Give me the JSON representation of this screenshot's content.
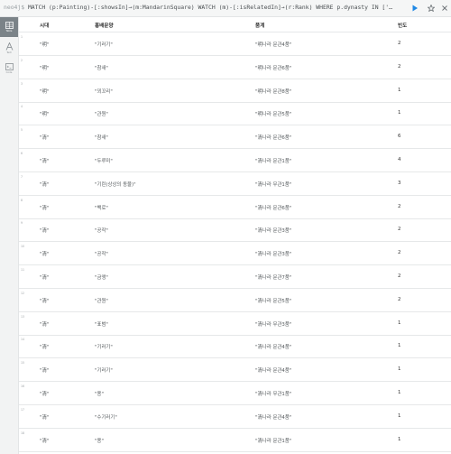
{
  "query_bar": {
    "prompt": "neo4j$",
    "query": "MATCH (p:Painting)-[:showsIn]→(m:MandarinSquare) WATCH (m)-[:isRelatedIn]→(r:Rank) WHERE p.dynasty IN ['…"
  },
  "toolbar": {
    "run_icon": "play-icon",
    "favorite_icon": "star-icon",
    "close_icon": "close-icon",
    "accent_color": "#1e88e5"
  },
  "sidebar": {
    "items": [
      {
        "label": "Table",
        "icon": "table-icon",
        "active": true
      },
      {
        "label": "Text",
        "icon": "text-icon",
        "active": false
      },
      {
        "label": "Code",
        "icon": "code-icon",
        "active": false
      }
    ]
  },
  "table": {
    "headers": [
      "시대",
      "흉배문양",
      "품계",
      "빈도"
    ],
    "rows": [
      {
        "n": "1",
        "cells": [
          "\"明\"",
          "\"기러기\"",
          "\"明나라 문관4품\"",
          "2"
        ]
      },
      {
        "n": "2",
        "cells": [
          "\"明\"",
          "\"참새\"",
          "\"明나라 문관6품\"",
          "2"
        ]
      },
      {
        "n": "3",
        "cells": [
          "\"明\"",
          "\"꾀꼬리\"",
          "\"明나라 문관8품\"",
          "1"
        ]
      },
      {
        "n": "4",
        "cells": [
          "\"明\"",
          "\"관원\"",
          "\"明나라 문관5품\"",
          "1"
        ]
      },
      {
        "n": "5",
        "cells": [
          "\"清\"",
          "\"참새\"",
          "\"清나라 문관6품\"",
          "6"
        ]
      },
      {
        "n": "6",
        "cells": [
          "\"清\"",
          "\"두루미\"",
          "\"清나라 문관1품\"",
          "4"
        ]
      },
      {
        "n": "7",
        "cells": [
          "\"清\"",
          "\"기린(상상의 동물)\"",
          "\"清나라 무관1품\"",
          "3"
        ]
      },
      {
        "n": "8",
        "cells": [
          "\"清\"",
          "\"백로\"",
          "\"清나라 문관6품\"",
          "2"
        ]
      },
      {
        "n": "9",
        "cells": [
          "\"清\"",
          "\"공작\"",
          "\"清나라 문관3품\"",
          "2"
        ]
      },
      {
        "n": "10",
        "cells": [
          "\"清\"",
          "\"공작\"",
          "\"清나라 문관3품\"",
          "2"
        ]
      },
      {
        "n": "11",
        "cells": [
          "\"清\"",
          "\"금앵\"",
          "\"清나라 문관7품\"",
          "2"
        ]
      },
      {
        "n": "12",
        "cells": [
          "\"清\"",
          "\"관원\"",
          "\"清나라 문관5품\"",
          "2"
        ]
      },
      {
        "n": "13",
        "cells": [
          "\"清\"",
          "\"표범\"",
          "\"清나라 무관3품\"",
          "1"
        ]
      },
      {
        "n": "14",
        "cells": [
          "\"清\"",
          "\"기러기\"",
          "\"清나라 문관4품\"",
          "1"
        ]
      },
      {
        "n": "15",
        "cells": [
          "\"清\"",
          "\"기러기\"",
          "\"清나라 문관4품\"",
          "1"
        ]
      },
      {
        "n": "16",
        "cells": [
          "\"清\"",
          "\"용\"",
          "\"清나라 무관1품\"",
          "1"
        ]
      },
      {
        "n": "17",
        "cells": [
          "\"清\"",
          "\"수기러기\"",
          "\"清나라 문관4품\"",
          "1"
        ]
      },
      {
        "n": "18",
        "cells": [
          "\"清\"",
          "\"용\"",
          "\"清나라 문관1품\"",
          "1"
        ]
      }
    ]
  }
}
